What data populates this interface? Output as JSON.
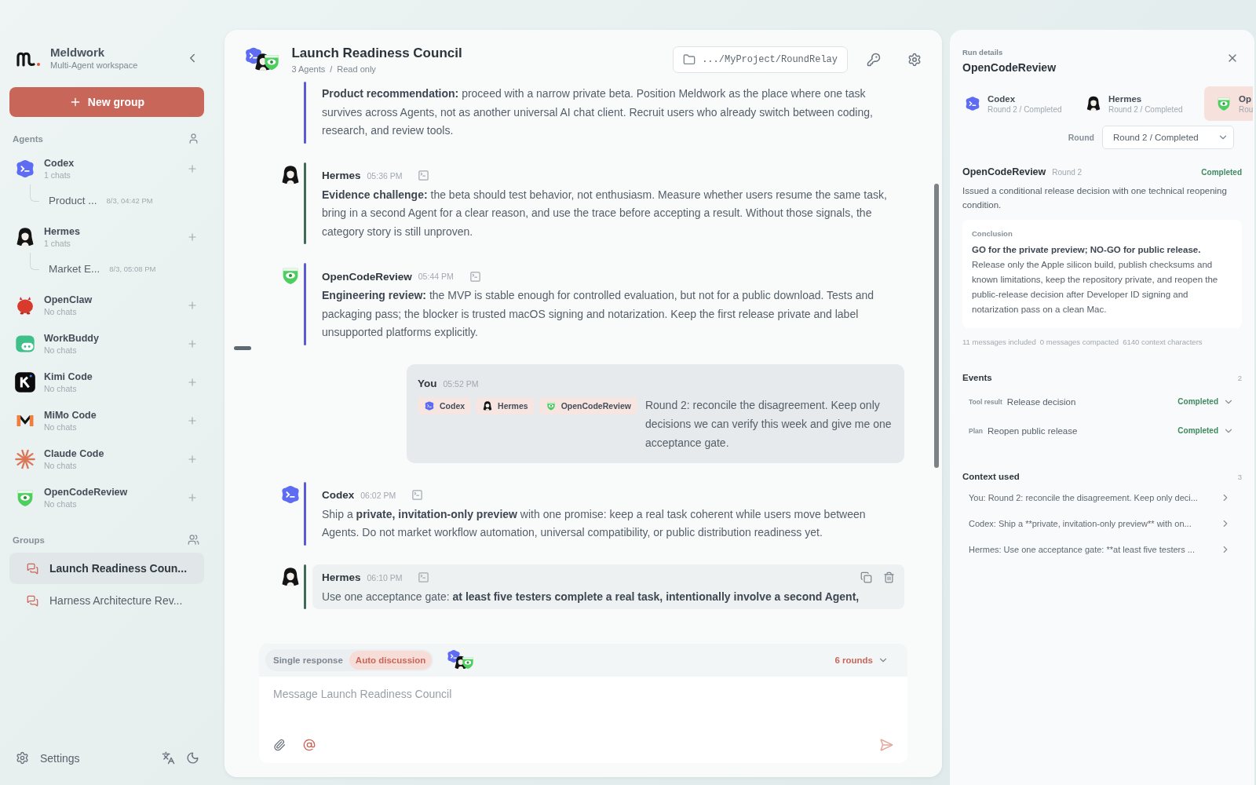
{
  "sidebar": {
    "brand": {
      "name": "Meldwork",
      "tagline": "Multi-Agent workspace"
    },
    "new_group_button": "New group",
    "agents_heading": "Agents",
    "agents": [
      {
        "kind": "codex",
        "name": "Codex",
        "subtitle": "1 chats",
        "chats": [
          {
            "title": "Product ...",
            "time": "8/3, 04:42 PM"
          }
        ]
      },
      {
        "kind": "hermes",
        "name": "Hermes",
        "subtitle": "1 chats",
        "chats": [
          {
            "title": "Market E...",
            "time": "8/3, 05:08 PM"
          }
        ]
      },
      {
        "kind": "openclaw",
        "name": "OpenClaw",
        "subtitle": "No chats"
      },
      {
        "kind": "workbuddy",
        "name": "WorkBuddy",
        "subtitle": "No chats"
      },
      {
        "kind": "kimi",
        "name": "Kimi Code",
        "subtitle": "No chats"
      },
      {
        "kind": "mimo",
        "name": "MiMo Code",
        "subtitle": "No chats"
      },
      {
        "kind": "claude",
        "name": "Claude Code",
        "subtitle": "No chats"
      },
      {
        "kind": "ocr",
        "name": "OpenCodeReview",
        "subtitle": "No chats"
      }
    ],
    "groups_heading": "Groups",
    "groups": [
      {
        "title": "Launch Readiness Coun...",
        "selected": true
      },
      {
        "title": "Harness Architecture Rev...",
        "selected": false
      }
    ],
    "settings": "Settings"
  },
  "conversation": {
    "title": "Launch Readiness Council",
    "members": [
      {
        "kind": "codex"
      },
      {
        "kind": "hermes"
      },
      {
        "kind": "ocr"
      }
    ],
    "meta": {
      "agents": "3 Agents",
      "separator": "/",
      "mode": "Read only"
    },
    "folder": ".../MyProject/RoundRelay",
    "messages": [
      {
        "kind": "agent",
        "color": "#5b5bd6",
        "hovered": false,
        "body": "**Product recommendation:** proceed with a narrow private beta. Position Meldwork as the place where one task survives across Agents, not as another universal AI chat client. Recruit users who already switch between coding, research, and review tools."
      },
      {
        "kind": "agent",
        "avatar": {
          "kind": "hermes"
        },
        "author": "Hermes",
        "time": "05:36 PM",
        "color": "#3f6b57",
        "hovered": false,
        "body": "**Evidence challenge:** the beta should test behavior, not enthusiasm. Measure whether users resume the same task, bring in a second Agent for a clear reason, and use the trace before accepting a result. Without those signals, the category story is still unproven."
      },
      {
        "kind": "agent",
        "avatar": {
          "kind": "ocr"
        },
        "author": "OpenCodeReview",
        "time": "05:44 PM",
        "color": "#5b5bd6",
        "hovered": false,
        "body": "**Engineering review:** the MVP is stable enough for controlled evaluation, but not for a public download. Tests and packaging pass; the blocker is trusted macOS signing and notarization. Keep the first release private and label unsupported platforms explicitly."
      },
      {
        "kind": "user",
        "author": "You",
        "time": "05:52 PM",
        "mentions": [
          {
            "kind": "codex",
            "name": "Codex"
          },
          {
            "kind": "hermes",
            "name": "Hermes"
          },
          {
            "kind": "ocr",
            "name": "OpenCodeReview"
          }
        ],
        "body": "Round 2: reconcile the disagreement. Keep only decisions we can verify this week and give me one acceptance gate."
      },
      {
        "kind": "agent",
        "avatar": {
          "kind": "codex"
        },
        "author": "Codex",
        "time": "06:02 PM",
        "color": "#5b5bd6",
        "hovered": false,
        "body": "Ship a **private, invitation-only preview** with one promise: keep a real task coherent while users move between Agents. Do not market workflow automation, universal compatibility, or public distribution readiness yet."
      },
      {
        "kind": "agent",
        "avatar": {
          "kind": "hermes"
        },
        "author": "Hermes",
        "time": "06:10 PM",
        "color": "#3f6b57",
        "hovered": true,
        "body": "Use one acceptance gate: **at least five testers complete a real task, intentionally involve a second Agent,**"
      }
    ],
    "composer": {
      "modes": [
        {
          "label": "Single response",
          "selected": false
        },
        {
          "label": "Auto discussion",
          "selected": true
        }
      ],
      "participants": [
        {
          "kind": "codex"
        },
        {
          "kind": "hermes"
        },
        {
          "kind": "ocr"
        }
      ],
      "rounds": "6 rounds",
      "placeholder": "Message Launch Readiness Council"
    }
  },
  "run_details": {
    "label": "Run details",
    "title": "OpenCodeReview",
    "agents": [
      {
        "kind": "codex",
        "name": "Codex",
        "status": "Round 2 / Completed",
        "selected": false
      },
      {
        "kind": "hermes",
        "name": "Hermes",
        "status": "Round 2 / Completed",
        "selected": false
      },
      {
        "kind": "ocr",
        "name": "Op",
        "status": "Rou",
        "selected": true
      }
    ],
    "round_label": "Round",
    "round_value": "Round 2 / Completed",
    "summary": {
      "agent": "OpenCodeReview",
      "round": "Round 2",
      "status": "Completed",
      "description": "Issued a conditional release decision with one technical reopening condition."
    },
    "conclusion": {
      "label": "Conclusion",
      "text": "**GO for the private preview; NO-GO for public release.** Release only the Apple silicon build, publish checksums and known limitations, keep the repository private, and reopen the public-release decision after Developer ID signing and notarization pass on a clean Mac."
    },
    "stats": [
      "11 messages included",
      "0 messages compacted",
      "6140 context characters"
    ],
    "events": {
      "heading": "Events",
      "count": "2",
      "items": [
        {
          "type": "Tool result",
          "title": "Release decision",
          "status": "Completed"
        },
        {
          "type": "Plan",
          "title": "Reopen public release",
          "status": "Completed"
        }
      ]
    },
    "context": {
      "heading": "Context used",
      "count": "3",
      "items": [
        "You: Round 2: reconcile the disagreement. Keep only deci...",
        "Codex: Ship a **private, invitation-only preview** with on...",
        "Hermes: Use one acceptance gate: **at least five testers ..."
      ]
    }
  }
}
